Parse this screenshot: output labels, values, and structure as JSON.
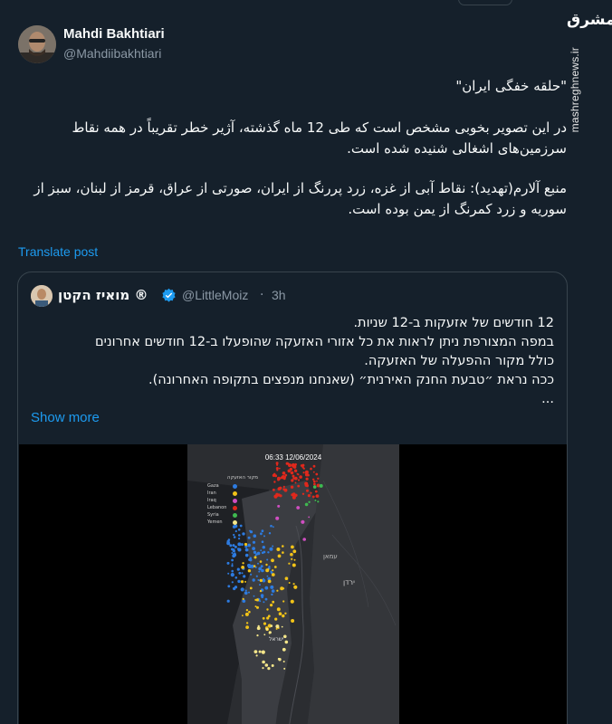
{
  "author": {
    "name": "Mahdi Bakhtiari",
    "handle": "@Mahdiibakhtiari"
  },
  "post": {
    "paragraphs": [
      "\"حلقه خفگی ایران\"",
      "در این تصویر بخوبی مشخص است که طی 12 ماه گذشته، آژیر خطر تقریباً در همه نقاط سرزمین‌های اشغالی شنیده شده است.",
      "منبع آلارم(تهدید): نقاط آبی از غزه، زرد پررنگ از ایران، صورتی از عراق، قرمز از لبنان، سبز از سوریه و زرد کمرنگ از یمن بوده است."
    ],
    "translate_label": "Translate post"
  },
  "watermark": {
    "logo": "مشرق",
    "url": "mashreghnews.ir"
  },
  "quote": {
    "name": "מואיז הקטן ®",
    "handle": "@LittleMoiz",
    "separator": "·",
    "time": "3h",
    "lines": [
      "12 חודשים של אזעקות ב-12 שניות.",
      "במפה המצורפת ניתן לראות את כל אזורי האזעקה שהופעלו ב-12 חודשים אחרונים",
      "כולל מקור ההפעלה של האזעקה.",
      "ככה נראת ״טבעת החנק האירנית״ (שאנחנו מנפצים בתקופה האחרונה).",
      "..."
    ],
    "show_more_label": "Show more",
    "media": {
      "timestamp": "06:33 12/06/2024",
      "legend_title": "מקור האזעקה",
      "legend": [
        {
          "label": "Gaza",
          "color": "#2d7be0"
        },
        {
          "label": "Iran",
          "color": "#f2c318"
        },
        {
          "label": "Iraq",
          "color": "#d04fc2"
        },
        {
          "label": "Lebanon",
          "color": "#e0281c"
        },
        {
          "label": "Syria",
          "color": "#3fb950"
        },
        {
          "label": "Yemen",
          "color": "#f5e68a"
        }
      ],
      "map_labels": {
        "jordan": "ירדן",
        "israel": "ישראל",
        "amman": "עמאן"
      }
    }
  }
}
